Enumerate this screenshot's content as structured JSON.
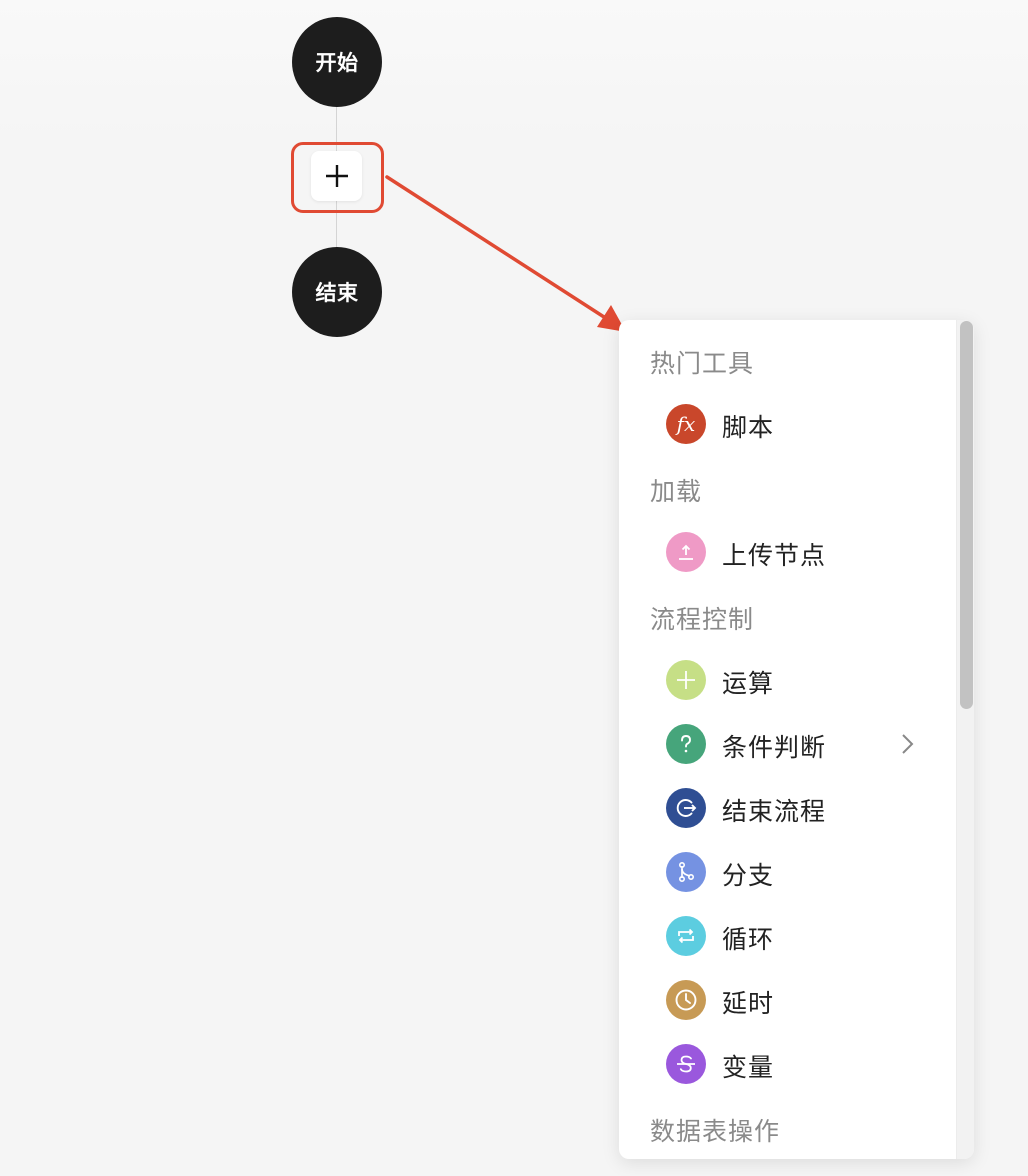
{
  "flow": {
    "start_label": "开始",
    "end_label": "结束"
  },
  "menu": {
    "sections": [
      {
        "title": "热门工具",
        "items": [
          {
            "label": "脚本",
            "icon": "fx-icon",
            "color": "#c9472b"
          }
        ]
      },
      {
        "title": "加载",
        "items": [
          {
            "label": "上传节点",
            "icon": "upload-icon",
            "color": "#ef9ac6"
          }
        ]
      },
      {
        "title": "流程控制",
        "items": [
          {
            "label": "运算",
            "icon": "plus-icon",
            "color": "#c6df86"
          },
          {
            "label": "条件判断",
            "icon": "question-icon",
            "color": "#46a57b",
            "has_submenu": true
          },
          {
            "label": "结束流程",
            "icon": "exit-icon",
            "color": "#2f4e93"
          },
          {
            "label": "分支",
            "icon": "branch-icon",
            "color": "#7592e2"
          },
          {
            "label": "循环",
            "icon": "loop-icon",
            "color": "#5ccde0"
          },
          {
            "label": "延时",
            "icon": "clock-icon",
            "color": "#c79a55"
          },
          {
            "label": "变量",
            "icon": "strikethrough-icon",
            "color": "#9a58dd"
          }
        ]
      },
      {
        "title": "数据表操作",
        "items": []
      }
    ]
  },
  "colors": {
    "node_dark": "#1d1d1d",
    "highlight_red": "#e04a33"
  }
}
